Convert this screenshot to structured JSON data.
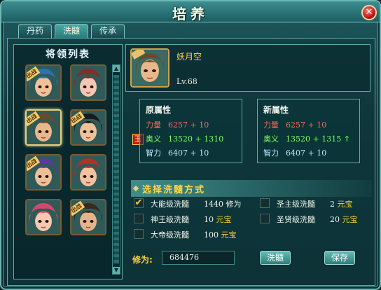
{
  "window": {
    "title": "培养",
    "close_glyph": "✕"
  },
  "tabs": [
    {
      "label": "丹药",
      "active": false
    },
    {
      "label": "洗髓",
      "active": true
    },
    {
      "label": "传承",
      "active": false
    }
  ],
  "general_list": {
    "title": "将领列表",
    "portraits": [
      {
        "name": "general-1",
        "badge": "出战",
        "hair": "#2f6fb5",
        "skin": "#f2c19a",
        "selected": false
      },
      {
        "name": "general-2",
        "badge": "",
        "hair": "#8a2a2a",
        "skin": "#f5c6b3",
        "selected": false
      },
      {
        "name": "general-3",
        "badge": "出战",
        "hair": "#6b4a2a",
        "skin": "#e9b88a",
        "selected": true
      },
      {
        "name": "general-4",
        "badge": "出战",
        "hair": "#1a1a1a",
        "skin": "#ecc29a",
        "selected": false
      },
      {
        "name": "general-5",
        "badge": "出战",
        "hair": "#5a3a9a",
        "skin": "#eebf98",
        "selected": false
      },
      {
        "name": "general-6",
        "badge": "",
        "hair": "#b0302a",
        "skin": "#f2c2a0",
        "selected": false
      },
      {
        "name": "general-7",
        "badge": "",
        "hair": "#d04a6a",
        "skin": "#f6c8b0",
        "selected": false
      },
      {
        "name": "general-8",
        "badge": "出战",
        "hair": "#3a2a1a",
        "skin": "#e5b48a",
        "selected": false
      }
    ]
  },
  "hero": {
    "name": "妖月空",
    "level": "Lv.68",
    "badge": "出战"
  },
  "original": {
    "title": "原属性",
    "rows": [
      {
        "key": "力量",
        "value": "6257 + 10",
        "class": "c-str"
      },
      {
        "key": "奥义",
        "value": "13520 + 1310",
        "class": "c-mag"
      },
      {
        "key": "智力",
        "value": "6407 + 10",
        "class": "c-int"
      }
    ]
  },
  "new": {
    "title": "新属性",
    "rows": [
      {
        "key": "力量",
        "value": "6257 + 10",
        "class": "c-str",
        "arrow": ""
      },
      {
        "key": "奥义",
        "value": "13520 + 1315",
        "class": "c-mag",
        "arrow": "↑"
      },
      {
        "key": "智力",
        "value": "6407 + 10",
        "class": "c-int",
        "arrow": ""
      }
    ]
  },
  "seal_char": "玉",
  "method": {
    "title": "选择洗髓方式",
    "options": [
      {
        "label": "大能级洗髓",
        "cost_num": "1440",
        "cost_unit": "修为",
        "checked": true
      },
      {
        "label": "圣主级洗髓",
        "cost_num": "2",
        "cost_unit": "元宝",
        "checked": false
      },
      {
        "label": "神王级洗髓",
        "cost_num": "10",
        "cost_unit": "元宝",
        "checked": false
      },
      {
        "label": "圣贤级洗髓",
        "cost_num": "20",
        "cost_unit": "元宝",
        "checked": false
      },
      {
        "label": "大帝级洗髓",
        "cost_num": "100",
        "cost_unit": "元宝",
        "checked": false
      }
    ]
  },
  "xiuwei": {
    "label": "修为:",
    "value": "684476"
  },
  "buttons": {
    "refine": "洗髓",
    "save": "保存"
  },
  "colors": {
    "accent_gold": "#ffd23a",
    "strength": "#ff6a55",
    "mystic": "#7cff5a",
    "intellect": "#bfe6ff"
  }
}
